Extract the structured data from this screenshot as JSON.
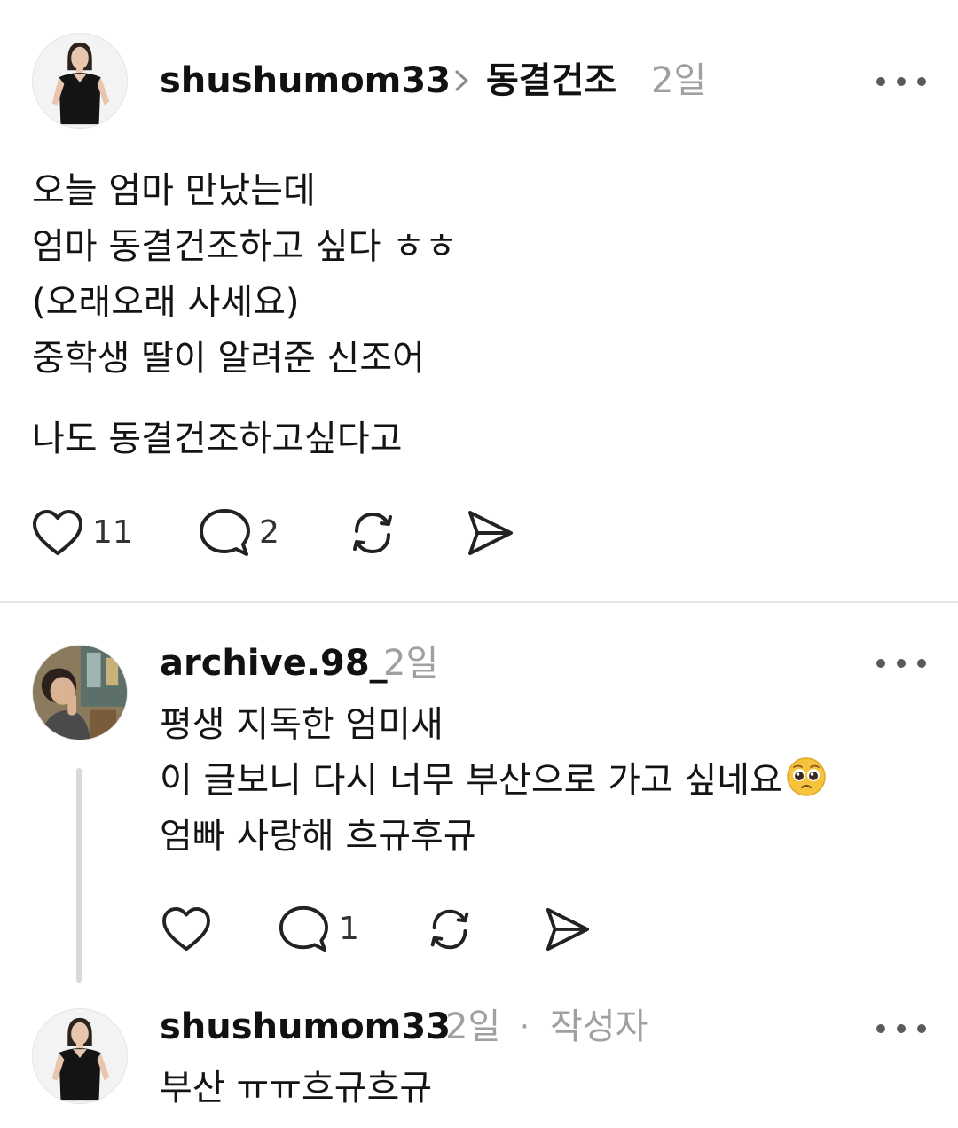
{
  "post": {
    "username": "shushumom33",
    "topic": "동결건조",
    "time": "2일",
    "lines": [
      "오늘 엄마 만났는데",
      "엄마 동결건조하고 싶다 ㅎㅎ",
      "(오래오래 사세요)",
      "중학생 딸이 알려준 신조어"
    ],
    "line2": "나도 동결건조하고싶다고",
    "likes": "11",
    "comments": "2"
  },
  "reply1": {
    "username": "archive.98_",
    "time": "2일",
    "lines": [
      "평생 지독한 엄미새",
      "이 글보니 다시 너무 부산으로 가고 싶네요",
      "엄빠 사랑해 흐규후규"
    ],
    "emoji": "pleading-face",
    "comments": "1"
  },
  "reply2": {
    "username": "shushumom33",
    "time": "2일",
    "separator": "·",
    "author_badge": "작성자",
    "text": "부산 ㅠㅠ흐규흐규"
  },
  "colors": {
    "text": "#111111",
    "muted": "#a0a0a0",
    "divider": "#e6e6e6",
    "thread_line": "#d9d9d9"
  },
  "icons": [
    "heart-icon",
    "comment-icon",
    "repost-icon",
    "share-icon",
    "more-icon",
    "chevron-right-icon"
  ]
}
